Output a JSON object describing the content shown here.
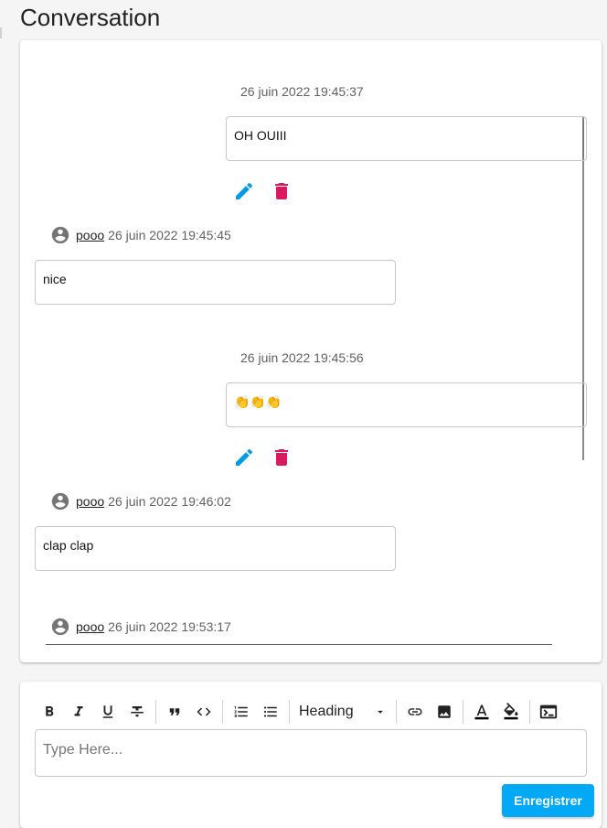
{
  "page": {
    "title": "Conversation"
  },
  "messages": [
    {
      "side": "right",
      "timestamp": "26 juin 2022 19:45:37",
      "text": "OH OUIII"
    },
    {
      "side": "left",
      "author": "pooo",
      "timestamp": "26 juin 2022 19:45:45",
      "text": "nice"
    },
    {
      "side": "right",
      "timestamp": "26 juin 2022 19:45:56",
      "text": "👏👏👏"
    },
    {
      "side": "left",
      "author": "pooo",
      "timestamp": "26 juin 2022 19:46:02",
      "text": "clap clap"
    },
    {
      "side": "left",
      "author": "pooo",
      "timestamp": "26 juin 2022 19:53:17",
      "text": ""
    }
  ],
  "colors": {
    "edit": "#039be5",
    "delete": "#d81b60",
    "primary": "#03a9f4"
  },
  "editor": {
    "toolbar": [
      "bold-icon",
      "italic-icon",
      "underline-icon",
      "strikethrough-icon",
      "quote-icon",
      "code-icon",
      "ordered-list-icon",
      "bullet-list-icon",
      "link-icon",
      "image-icon",
      "text-color-icon",
      "highlight-icon",
      "terminal-icon"
    ],
    "heading_label": "Heading",
    "placeholder": "Type Here...",
    "save_label": "Enregistrer"
  }
}
